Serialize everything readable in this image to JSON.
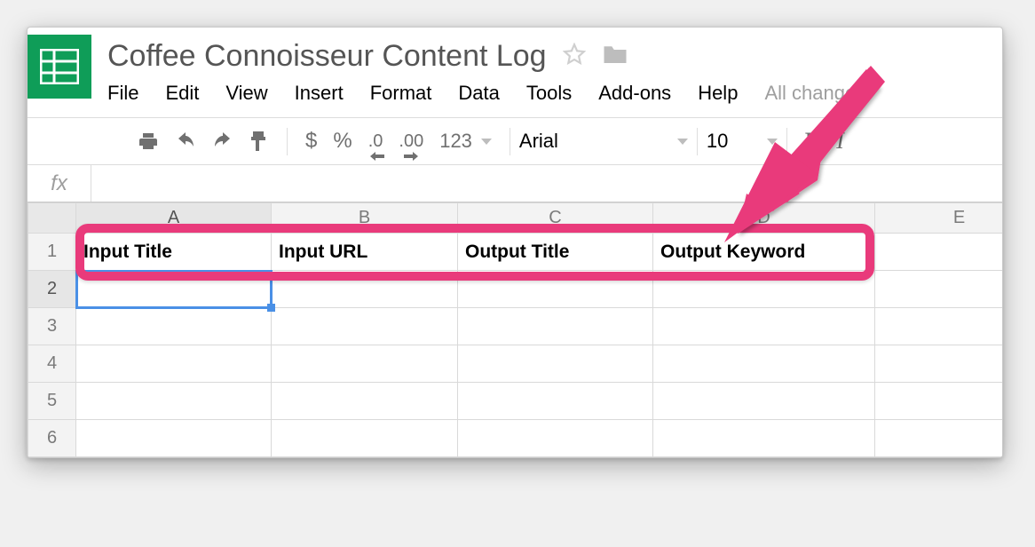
{
  "document": {
    "title": "Coffee Connoisseur Content Log"
  },
  "menus": {
    "file": "File",
    "edit": "Edit",
    "view": "View",
    "insert": "Insert",
    "format": "Format",
    "data": "Data",
    "tools": "Tools",
    "addons": "Add-ons",
    "help": "Help",
    "changes": "All change"
  },
  "toolbar": {
    "currency": "$",
    "percent": "%",
    "dec_less": ".0",
    "dec_more": ".00",
    "number_format": "123",
    "font_name": "Arial",
    "font_size": "10",
    "bold": "B",
    "italic": "I"
  },
  "formula_bar": {
    "label": "fx",
    "value": ""
  },
  "columns": [
    "A",
    "B",
    "C",
    "D",
    "E"
  ],
  "rows": [
    "1",
    "2",
    "3",
    "4",
    "5",
    "6"
  ],
  "headers": {
    "A": "Input Title",
    "B": "Input URL",
    "C": "Output Title",
    "D": "Output Keyword"
  },
  "selection": {
    "active_col": "A",
    "active_row": "2"
  }
}
